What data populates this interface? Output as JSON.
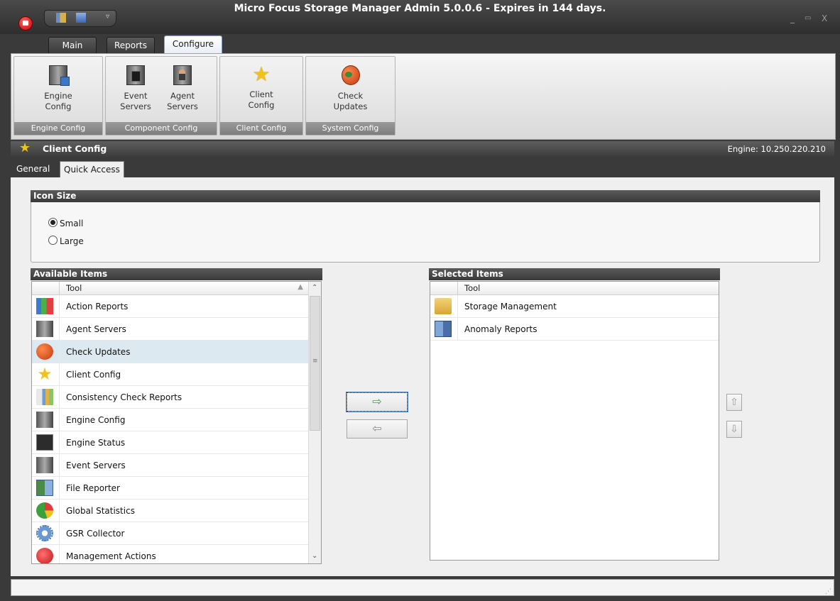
{
  "window": {
    "title": "Micro Focus Storage Manager Admin 5.0.0.6 - Expires in 144 days.",
    "controls": {
      "minimize": "_",
      "maximize": "▭",
      "close": "X"
    }
  },
  "ribbon_tabs": [
    {
      "label": "Main",
      "active": false
    },
    {
      "label": "Reports",
      "active": false
    },
    {
      "label": "Configure",
      "active": true
    }
  ],
  "ribbon_groups": [
    {
      "label": "Engine Config",
      "buttons": [
        {
          "label_line1": "Engine",
          "label_line2": "Config",
          "icon": "engine-config-icon"
        }
      ]
    },
    {
      "label": "Component Config",
      "buttons": [
        {
          "label_line1": "Event",
          "label_line2": "Servers",
          "icon": "event-servers-icon"
        },
        {
          "label_line1": "Agent",
          "label_line2": "Servers",
          "icon": "agent-servers-icon"
        }
      ]
    },
    {
      "label": "Client Config",
      "buttons": [
        {
          "label_line1": "Client",
          "label_line2": "Config",
          "icon": "star-icon"
        }
      ]
    },
    {
      "label": "System Config",
      "buttons": [
        {
          "label_line1": "Check",
          "label_line2": "Updates",
          "icon": "check-updates-icon"
        }
      ]
    }
  ],
  "content_header": {
    "title": "Client Config",
    "engine": "Engine:  10.250.220.210"
  },
  "subtabs": [
    {
      "label": "General",
      "active": false
    },
    {
      "label": "Quick Access",
      "active": true
    }
  ],
  "icon_size": {
    "heading": "Icon Size",
    "options": [
      {
        "label": "Small",
        "selected": true
      },
      {
        "label": "Large",
        "selected": false
      }
    ]
  },
  "available_items": {
    "heading": "Available Items",
    "column": "Tool",
    "items": [
      {
        "label": "Action Reports",
        "icon": "action-reports-icon"
      },
      {
        "label": "Agent Servers",
        "icon": "agent-servers-icon"
      },
      {
        "label": "Check Updates",
        "icon": "check-updates-icon",
        "selected": true
      },
      {
        "label": "Client Config",
        "icon": "client-config-icon"
      },
      {
        "label": "Consistency Check Reports",
        "icon": "consistency-check-icon"
      },
      {
        "label": "Engine Config",
        "icon": "engine-config-icon"
      },
      {
        "label": "Engine Status",
        "icon": "engine-status-icon"
      },
      {
        "label": "Event Servers",
        "icon": "event-servers-icon"
      },
      {
        "label": "File Reporter",
        "icon": "file-reporter-icon"
      },
      {
        "label": "Global Statistics",
        "icon": "global-statistics-icon"
      },
      {
        "label": "GSR Collector",
        "icon": "gsr-collector-icon"
      },
      {
        "label": "Management Actions",
        "icon": "management-actions-icon"
      }
    ]
  },
  "selected_items": {
    "heading": "Selected Items",
    "column": "Tool",
    "items": [
      {
        "label": "Storage Management",
        "icon": "storage-management-icon"
      },
      {
        "label": "Anomaly Reports",
        "icon": "anomaly-reports-icon"
      }
    ]
  },
  "transfer_buttons": {
    "add": "⇨",
    "remove": "⇦"
  },
  "order_buttons": {
    "up": "⇧",
    "down": "⇩"
  }
}
